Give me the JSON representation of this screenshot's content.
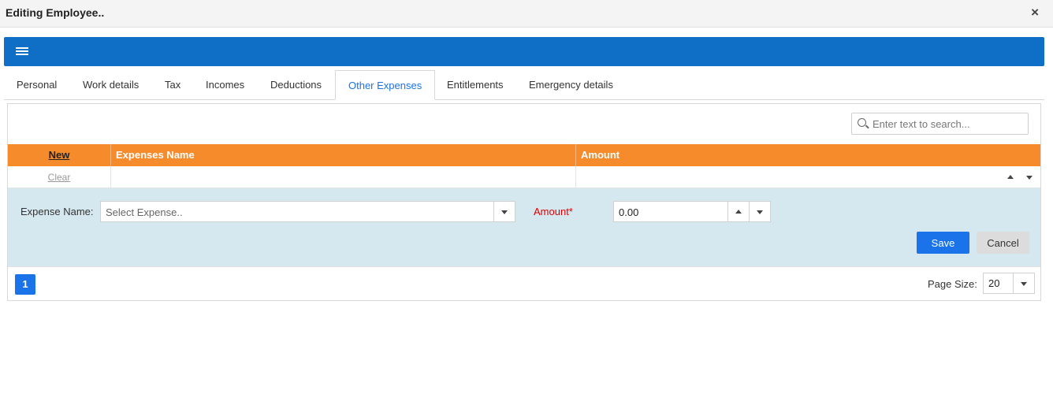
{
  "window": {
    "title": "Editing Employee..",
    "close_glyph": "×"
  },
  "toolbar": {
    "menu_icon": "hamburger-menu-icon",
    "color": "#0f6fc6"
  },
  "tabs": [
    {
      "label": "Personal",
      "active": false
    },
    {
      "label": "Work details",
      "active": false
    },
    {
      "label": "Tax",
      "active": false
    },
    {
      "label": "Incomes",
      "active": false
    },
    {
      "label": "Deductions",
      "active": false
    },
    {
      "label": "Other Expenses",
      "active": true
    },
    {
      "label": "Entitlements",
      "active": false
    },
    {
      "label": "Emergency details",
      "active": false
    }
  ],
  "search": {
    "placeholder": "Enter text to search...",
    "icon": "search-icon"
  },
  "grid": {
    "header_color": "#f68b2c",
    "columns": {
      "new_label": "New",
      "expenses_name": "Expenses Name",
      "amount": "Amount"
    },
    "filter_row": {
      "clear_label": "Clear"
    }
  },
  "edit_form": {
    "expense_name_label": "Expense Name:",
    "expense_placeholder": "Select Expense..",
    "amount_label": "Amount*",
    "amount_value": "0.00",
    "save_label": "Save",
    "cancel_label": "Cancel"
  },
  "pager": {
    "current_page": "1",
    "page_size_label": "Page Size:",
    "page_size_value": "20"
  }
}
